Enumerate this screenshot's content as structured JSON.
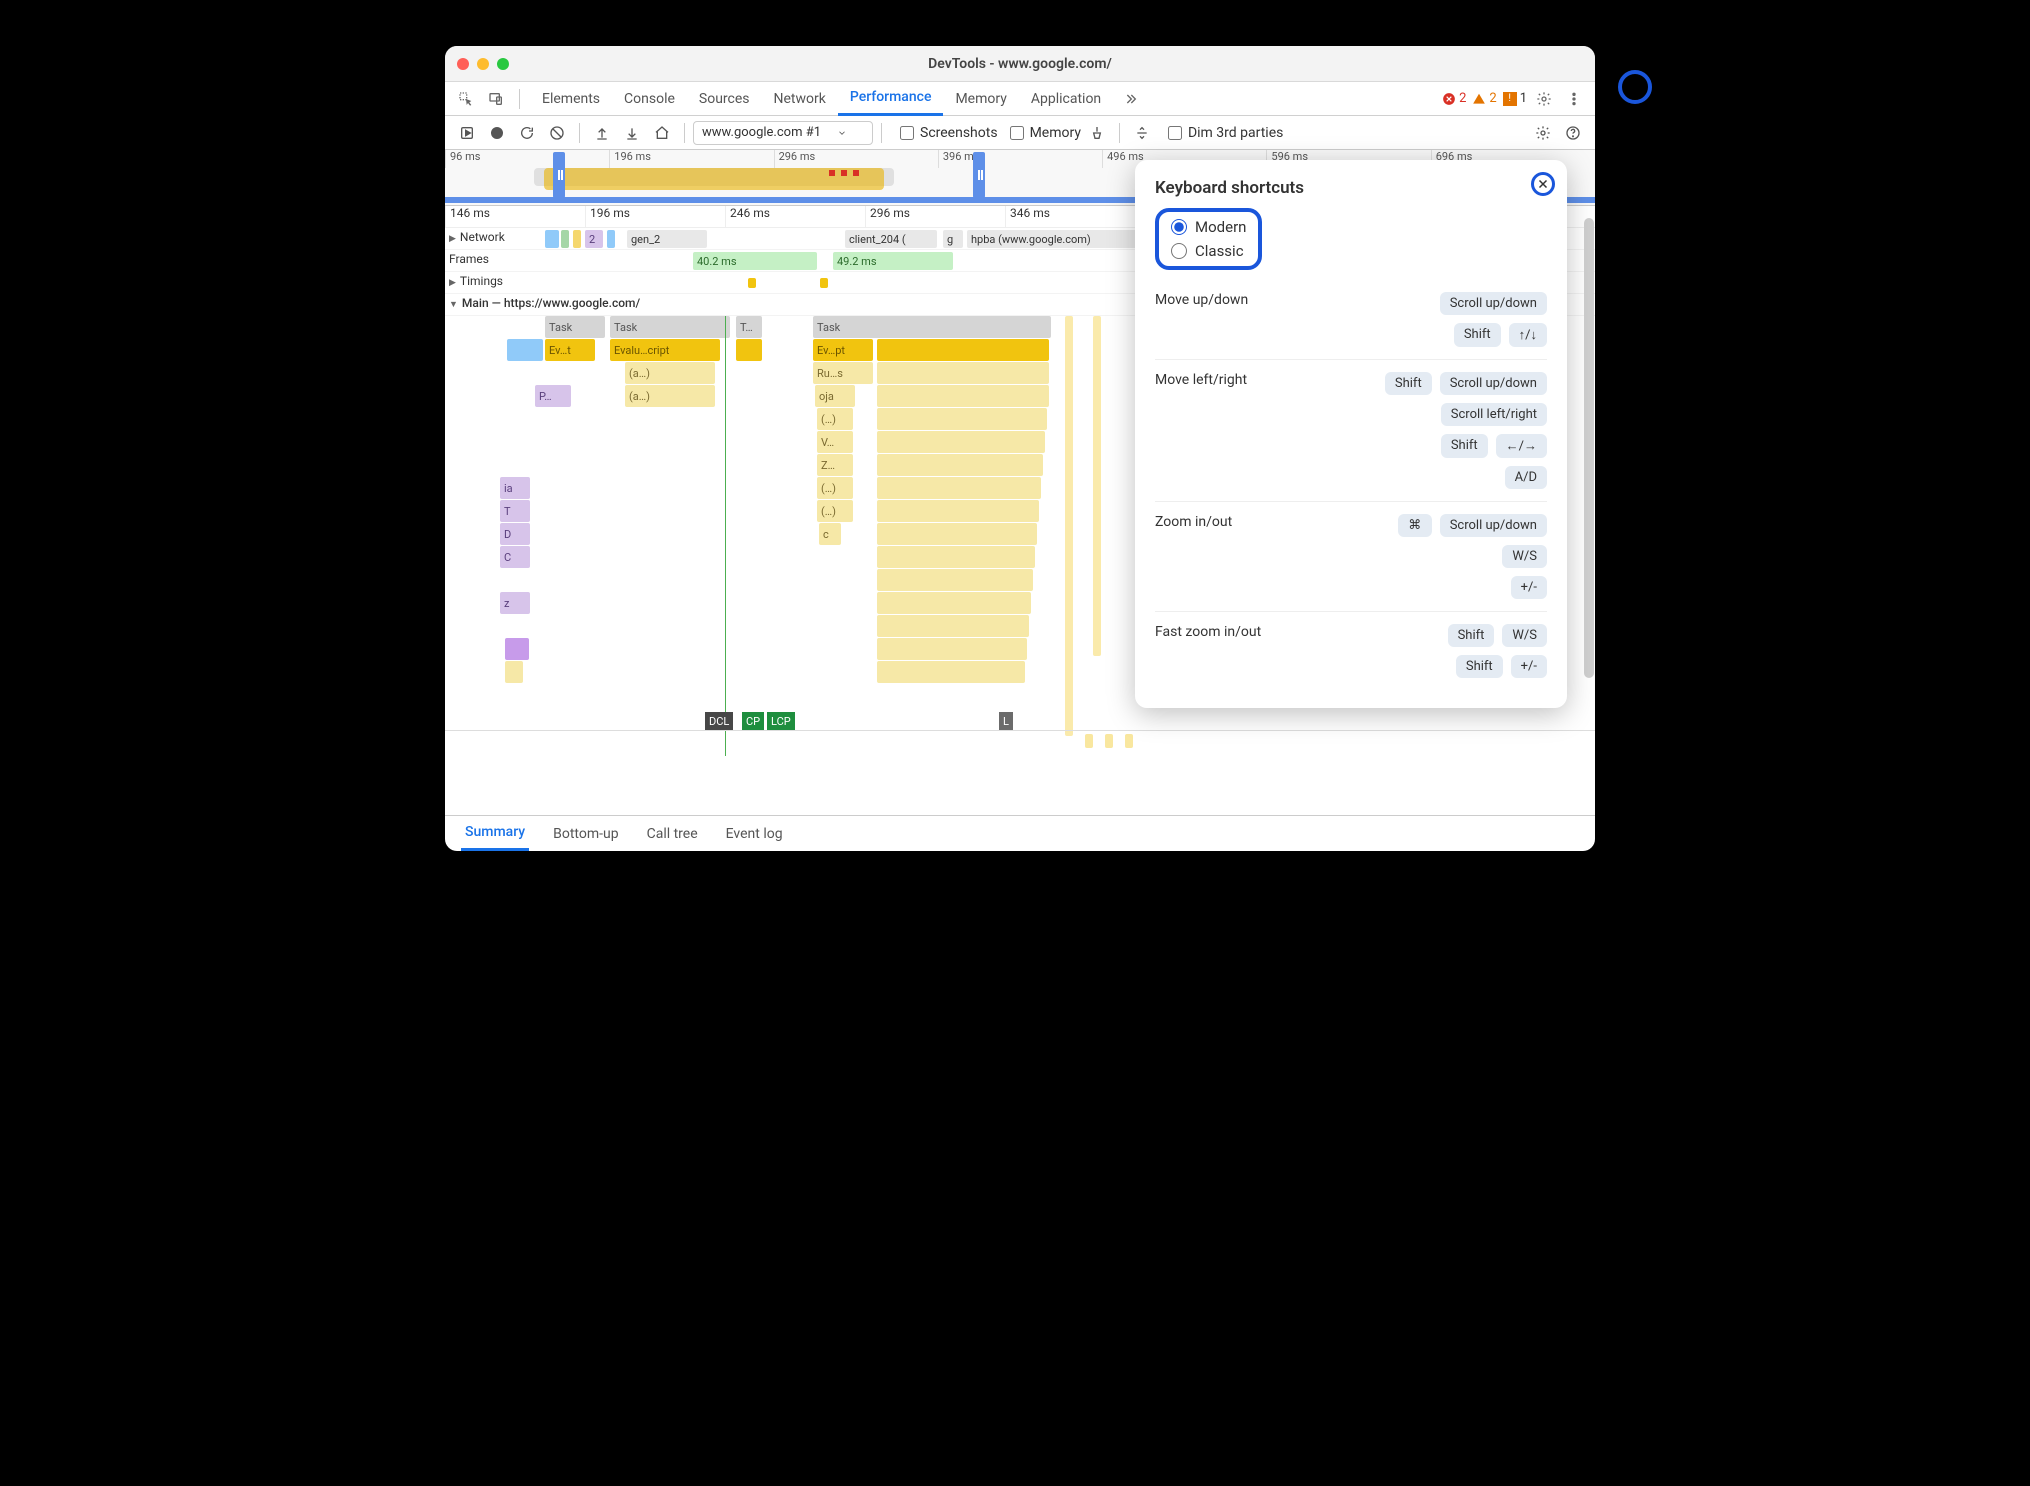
{
  "window": {
    "title": "DevTools - www.google.com/"
  },
  "mainTabs": [
    "Elements",
    "Console",
    "Sources",
    "Network",
    "Performance",
    "Memory",
    "Application"
  ],
  "activeMainTab": "Performance",
  "badges": {
    "errors": "2",
    "warnings": "2",
    "info": "1"
  },
  "toolbar": {
    "comboLabel": "www.google.com #1",
    "screenshots": "Screenshots",
    "memory": "Memory",
    "dim": "Dim 3rd parties"
  },
  "overviewTicks": [
    "96 ms",
    "196 ms",
    "296 ms",
    "396 ms",
    "496 ms",
    "596 ms",
    "696 ms"
  ],
  "rulerTicks": [
    "146 ms",
    "196 ms",
    "246 ms",
    "296 ms",
    "346 ms"
  ],
  "rows": {
    "network": "Network",
    "frames": "Frames",
    "timings": "Timings",
    "main": "Main — https://www.google.com/"
  },
  "networkItems": {
    "a": "2",
    "b": "gen_2",
    "c": "client_204 (",
    "d": "g",
    "e": "hpba (www.google.com)"
  },
  "frameTimes": {
    "a": "40.2 ms",
    "b": "49.2 ms"
  },
  "mainbars": {
    "task": "Task",
    "tdots": "T…",
    "ev_t": "Ev…t",
    "eval": "Evalu…cript",
    "ev_pt": "Ev…pt",
    "a": "(a…)",
    "p": "P…",
    "ru": "Ru…s",
    "oja": "oja",
    "dots": "(…)",
    "v": "V…",
    "z": "Z…",
    "ia": "ia",
    "T": "T",
    "D": "D",
    "C": "C",
    "zz": "z",
    "c": "c"
  },
  "markers": {
    "dcl": "DCL",
    "cp": "CP",
    "lcp": "LCP",
    "l": "L"
  },
  "bottomTabs": [
    "Summary",
    "Bottom-up",
    "Call tree",
    "Event log"
  ],
  "activeBottomTab": "Summary",
  "panel": {
    "title": "Keyboard shortcuts",
    "modern": "Modern",
    "classic": "Classic",
    "rows": [
      {
        "label": "Move up/down",
        "keys": [
          [
            "Scroll up/down"
          ],
          [
            "Shift",
            "↑/↓"
          ]
        ]
      },
      {
        "label": "Move left/right",
        "keys": [
          [
            "Shift",
            "Scroll up/down"
          ],
          [
            "Scroll left/right"
          ],
          [
            "Shift",
            "←/→"
          ],
          [
            "A/D"
          ]
        ]
      },
      {
        "label": "Zoom in/out",
        "keys": [
          [
            "⌘",
            "Scroll up/down"
          ],
          [
            "W/S"
          ],
          [
            "+/-"
          ]
        ]
      },
      {
        "label": "Fast zoom in/out",
        "keys": [
          [
            "Shift",
            "W/S"
          ],
          [
            "Shift",
            "+/-"
          ]
        ]
      }
    ]
  }
}
